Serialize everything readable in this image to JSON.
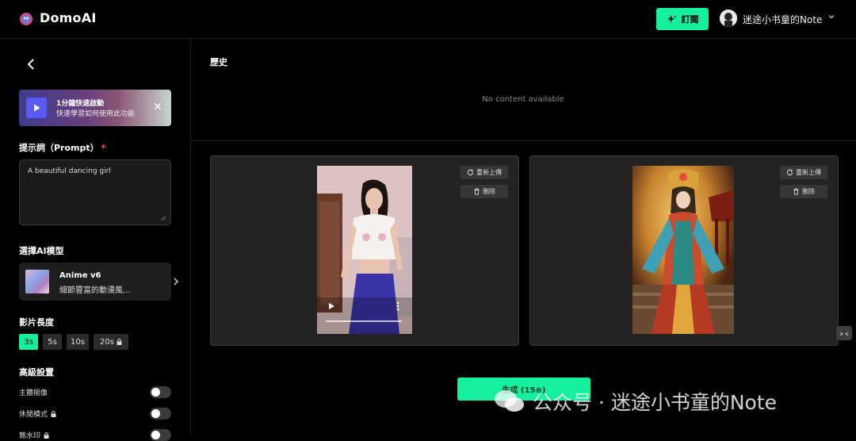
{
  "header": {
    "app_name": "DomoAI",
    "subscribe_label": "訂閱",
    "user_name": "迷途小书童的Note"
  },
  "sidebar": {
    "banner": {
      "title": "1分鐘快速啟動",
      "subtitle": "快速學習如何使用此功能"
    },
    "prompt": {
      "label": "提示詞（Prompt）",
      "required_mark": "*",
      "value": "A beautiful dancing girl"
    },
    "model": {
      "section_label": "選擇AI模型",
      "name": "Anime v6",
      "description": "細節豐富的動漫風..."
    },
    "duration": {
      "section_label": "影片長度",
      "options": [
        "3s",
        "5s",
        "10s",
        "20s"
      ],
      "selected": "3s"
    },
    "advanced": {
      "section_label": "高級設置",
      "items": [
        {
          "label": "主體摳像",
          "locked": false,
          "enabled": false
        },
        {
          "label": "休閒模式",
          "locked": true,
          "enabled": false
        },
        {
          "label": "無水印",
          "locked": true,
          "enabled": false
        }
      ]
    }
  },
  "main": {
    "history_title": "歷史",
    "empty_text": "No content available",
    "cards": [
      {
        "reupload_label": "重新上傳",
        "delete_label": "刪除"
      },
      {
        "reupload_label": "重新上傳",
        "delete_label": "刪除"
      }
    ],
    "generate_label": "生成 (15⊕)"
  },
  "watermark_text": "公众号 · 迷途小书童的Note",
  "colors": {
    "accent": "#14f09c",
    "background": "#000000",
    "panel": "#232323",
    "required": "#ff4d6a"
  }
}
